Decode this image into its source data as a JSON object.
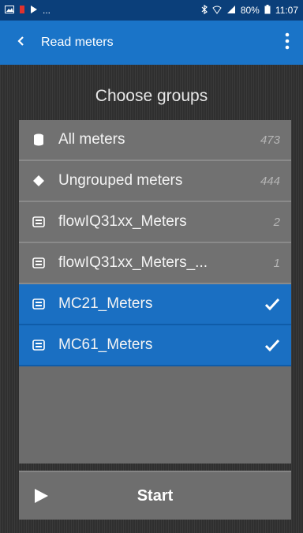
{
  "status_bar": {
    "left_text": "...",
    "battery": "80%",
    "time": "11:07"
  },
  "app_bar": {
    "title": "Read meters"
  },
  "heading": "Choose groups",
  "groups": [
    {
      "label": "All meters",
      "count": "473",
      "icon": "database-icon",
      "selected": false
    },
    {
      "label": "Ungrouped meters",
      "count": "444",
      "icon": "diamond-icon",
      "selected": false
    },
    {
      "label": "flowIQ31xx_Meters",
      "count": "2",
      "icon": "meter-group-icon",
      "selected": false
    },
    {
      "label": "flowIQ31xx_Meters_...",
      "count": "1",
      "icon": "meter-group-icon",
      "selected": false
    },
    {
      "label": "MC21_Meters",
      "count": "",
      "icon": "meter-group-icon",
      "selected": true
    },
    {
      "label": "MC61_Meters",
      "count": "",
      "icon": "meter-group-icon",
      "selected": true
    }
  ],
  "start_button": {
    "label": "Start"
  },
  "colors": {
    "status_bar": "#0b3f7a",
    "app_bar": "#1a74c8",
    "selected_row": "#1a6fc2",
    "row": "#717171"
  }
}
